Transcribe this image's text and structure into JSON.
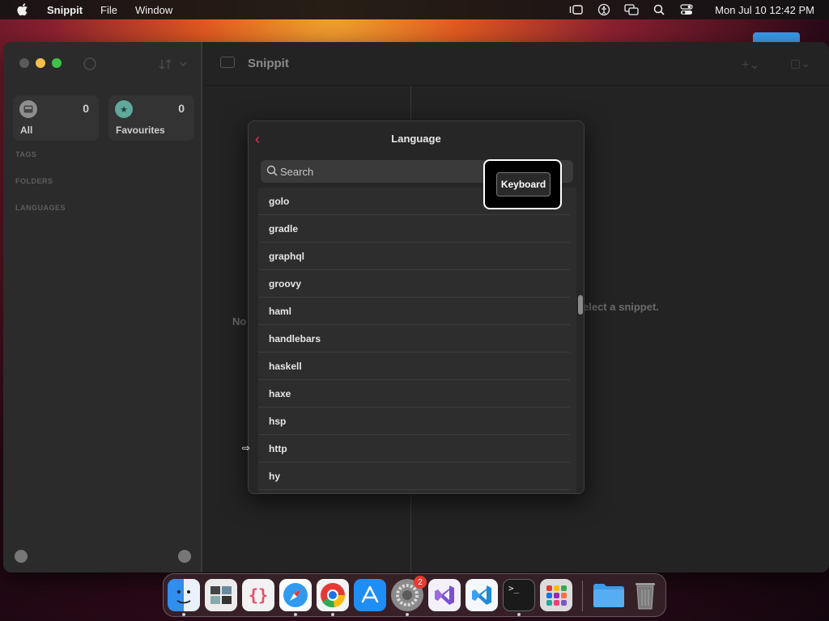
{
  "menubar": {
    "app_name": "Snippit",
    "menus": [
      "File",
      "Window"
    ],
    "clock": "Mon Jul 10  12:42 PM",
    "status_icons": [
      "stage-manager-icon",
      "accessibility-icon",
      "screen-mirroring-icon",
      "search-icon",
      "control-center-icon"
    ]
  },
  "window": {
    "title": "Snippit",
    "sidebar": {
      "tiles": [
        {
          "label": "All",
          "count": "0",
          "icon": "tray-icon",
          "color": "#8e8e8e"
        },
        {
          "label": "Favourites",
          "count": "0",
          "icon": "star-icon",
          "color": "#5fa89a"
        }
      ],
      "sections": [
        "TAGS",
        "FOLDERS",
        "LANGUAGES"
      ]
    },
    "list_empty_text": "No",
    "detail_empty_text": "elect a snippet."
  },
  "language_sheet": {
    "title": "Language",
    "search_placeholder": "Search",
    "languages": [
      "golo",
      "gradle",
      "graphql",
      "groovy",
      "haml",
      "handlebars",
      "haskell",
      "haxe",
      "hsp",
      "http",
      "hy"
    ]
  },
  "keyboard_overlay": {
    "label": "Keyboard"
  },
  "dock": {
    "apps": [
      {
        "name": "Finder",
        "icon": "finder-icon",
        "color": "#2f8ef0"
      },
      {
        "name": "Preview",
        "icon": "preview-icon",
        "color": "#e8e8e8"
      },
      {
        "name": "Snippit",
        "icon": "braces-icon",
        "color": "#e84a6a"
      },
      {
        "name": "Safari",
        "icon": "compass-icon",
        "color": "#2f9af0"
      },
      {
        "name": "Chrome",
        "icon": "chrome-icon",
        "color": "#f0c020"
      },
      {
        "name": "App Store",
        "icon": "appstore-icon",
        "color": "#1e8ef5"
      },
      {
        "name": "System Settings",
        "icon": "gear-icon",
        "color": "#8a8a8a",
        "badge": "2"
      },
      {
        "name": "Visual Studio",
        "icon": "visual-studio-icon",
        "color": "#7a4fd0"
      },
      {
        "name": "VS Code",
        "icon": "vscode-icon",
        "color": "#1e8ad8"
      },
      {
        "name": "Terminal",
        "icon": "terminal-icon",
        "color": "#1a1a1a"
      },
      {
        "name": "Launchpad",
        "icon": "launchpad-icon",
        "color": "#d8d8d8"
      }
    ],
    "right": [
      {
        "name": "Downloads",
        "icon": "folder-icon",
        "color": "#3a9be8"
      },
      {
        "name": "Trash",
        "icon": "trash-icon",
        "color": "#9a9a9a"
      }
    ]
  }
}
